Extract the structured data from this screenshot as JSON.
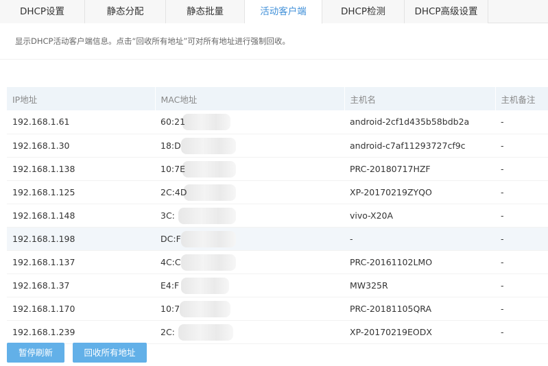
{
  "tabs": [
    {
      "label": "DHCP设置",
      "active": false
    },
    {
      "label": "静态分配",
      "active": false
    },
    {
      "label": "静态批量",
      "active": false
    },
    {
      "label": "活动客户端",
      "active": true
    },
    {
      "label": "DHCP检测",
      "active": false
    },
    {
      "label": "DHCP高级设置",
      "active": false
    }
  ],
  "description": "显示DHCP活动客户端信息。点击“回收所有地址”可对所有地址进行强制回收。",
  "table": {
    "headers": {
      "ip": "IP地址",
      "mac": "MAC地址",
      "hostname": "主机名",
      "note": "主机备注"
    },
    "rows": [
      {
        "ip": "192.168.1.61",
        "mac": "60:21",
        "hostname": "android-2cf1d435b58bdb2a",
        "note": "-"
      },
      {
        "ip": "192.168.1.30",
        "mac": "18:D",
        "hostname": "android-c7af11293727cf9c",
        "note": "-"
      },
      {
        "ip": "192.168.1.138",
        "mac": "10:7E",
        "hostname": "PRC-20180717HZF",
        "note": "-"
      },
      {
        "ip": "192.168.1.125",
        "mac": "2C:4D",
        "hostname": "XP-20170219ZYQO",
        "note": "-"
      },
      {
        "ip": "192.168.1.148",
        "mac": "3C:",
        "hostname": "vivo-X20A",
        "note": "-"
      },
      {
        "ip": "192.168.1.198",
        "mac": "DC:F",
        "hostname": "-",
        "note": "-"
      },
      {
        "ip": "192.168.1.137",
        "mac": "4C:C",
        "hostname": "PRC-20161102LMO",
        "note": "-"
      },
      {
        "ip": "192.168.1.37",
        "mac": "E4:F",
        "hostname": "MW325R",
        "note": "-"
      },
      {
        "ip": "192.168.1.170",
        "mac": "10:7",
        "hostname": "PRC-20181105QRA",
        "note": "-"
      },
      {
        "ip": "192.168.1.239",
        "mac": "2C:",
        "hostname": "XP-20170219EODX",
        "note": "-"
      }
    ]
  },
  "buttons": {
    "pause_refresh": "暂停刷新",
    "reclaim_all": "回收所有地址"
  },
  "colors": {
    "accent": "#3f8fd8",
    "button": "#62b0e8",
    "header_bg": "#eef4f9",
    "highlight_row": "#f2f6fa"
  }
}
